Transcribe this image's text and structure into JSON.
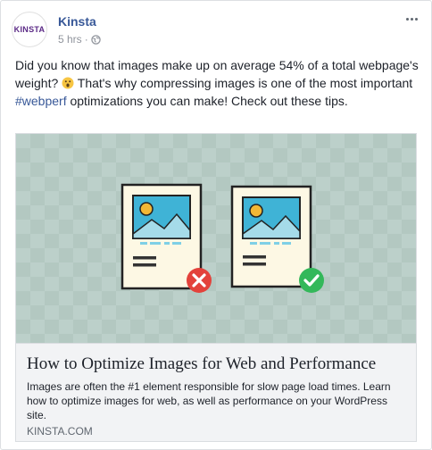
{
  "post": {
    "author": "Kinsta",
    "avatar_text": "KINSTA",
    "timestamp": "5 hrs",
    "separator": "·",
    "privacy_icon": "globe-icon",
    "more_icon": "more-options-icon",
    "message": {
      "part1": "Did you know that images make up on average 54% of a total webpage's weight? ",
      "emoji": "surprised-face-emoji",
      "part2": " That's why compressing images is one of the most important ",
      "hashtag": "#webperf",
      "part3": " optimizations you can make! Check out these tips."
    }
  },
  "link_card": {
    "title": "How to Optimize Images for Web and Performance",
    "description": "Images are often the #1 element responsible for slow page load times. Learn how to optimize images for web, as well as performance on your WordPress site.",
    "domain": "KINSTA.COM",
    "illustration": {
      "bad_badge_icon": "x-icon",
      "good_badge_icon": "check-icon",
      "colors": {
        "background": "#bcd0ca",
        "frame_bg": "#fdf8e4",
        "sky": "#3fb3d6",
        "sun": "#f2b736",
        "bad": "#e3423b",
        "good": "#33b85a"
      }
    }
  }
}
